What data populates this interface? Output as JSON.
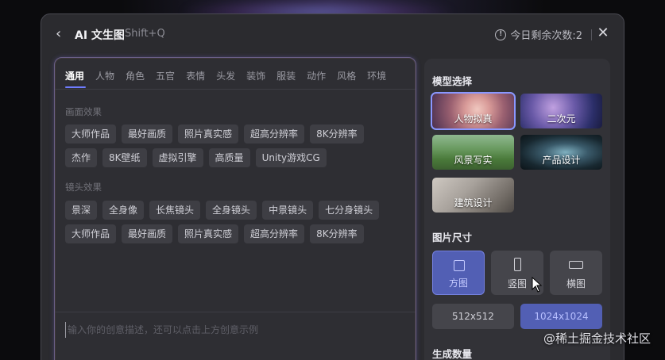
{
  "header": {
    "title": "AI 文生图",
    "shortcut": "Shift+Q",
    "quota_text": "今日剩余次数:2"
  },
  "tabs": [
    {
      "label": "通用",
      "active": true
    },
    {
      "label": "人物"
    },
    {
      "label": "角色"
    },
    {
      "label": "五官"
    },
    {
      "label": "表情"
    },
    {
      "label": "头发"
    },
    {
      "label": "装饰"
    },
    {
      "label": "服装"
    },
    {
      "label": "动作"
    },
    {
      "label": "风格"
    },
    {
      "label": "环境"
    }
  ],
  "sections": {
    "picture_effects": {
      "label": "画面效果",
      "row1": [
        "大师作品",
        "最好画质",
        "照片真实感",
        "超高分辨率",
        "8K分辨率"
      ],
      "row2": [
        "杰作",
        "8K壁纸",
        "虚拟引擎",
        "高质量",
        "Unity游戏CG"
      ]
    },
    "camera_effects": {
      "label": "镜头效果",
      "row1": [
        "景深",
        "全身像",
        "长焦镜头",
        "全身镜头",
        "中景镜头",
        "七分身镜头"
      ],
      "row2": [
        "大师作品",
        "最好画质",
        "照片真实感",
        "超高分辨率",
        "8K分辨率"
      ]
    }
  },
  "prompt": {
    "placeholder": "输入你的创意描述，还可以点击上方创意示例"
  },
  "right_panel": {
    "model_label": "模型选择",
    "models": [
      "人物拟真",
      "二次元",
      "风景写实",
      "产品设计",
      "建筑设计"
    ],
    "selected_model": "人物拟真",
    "size_label": "图片尺寸",
    "sizes": [
      "方图",
      "竖图",
      "横图"
    ],
    "selected_size": "方图",
    "resolutions": [
      "512x512",
      "1024x1024"
    ],
    "selected_resolution": "1024x1024",
    "count_label": "生成数量"
  },
  "watermark": "@稀土掘金技术社区",
  "colors": {
    "accent": "#6f7cff",
    "selected_bg": "#525fb4",
    "panel_bg": "#2b2b2f"
  }
}
